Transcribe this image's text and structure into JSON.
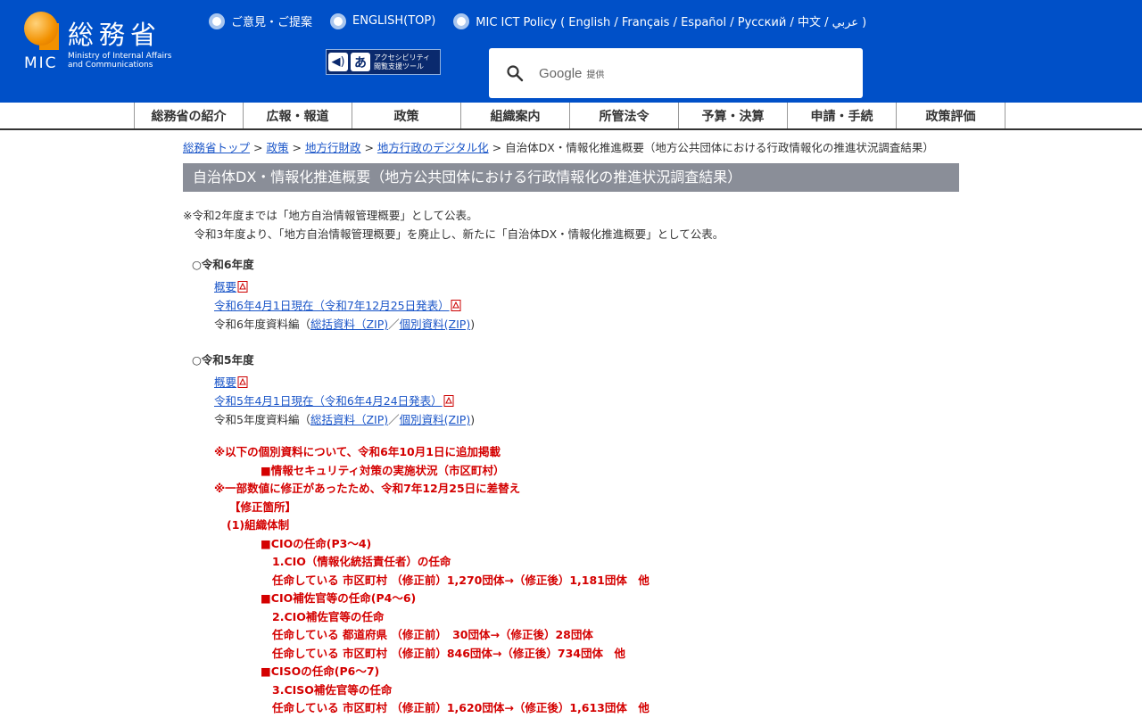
{
  "header": {
    "logo_kanji": "総務省",
    "logo_mic": "MIC",
    "logo_en_line1": "Ministry of Internal Affairs",
    "logo_en_line2": "and Communications",
    "links": [
      "ご意見・ご提案",
      "ENGLISH(TOP)",
      "MIC ICT Policy ( English / Français / Español / Русский / 中文 / عربي )"
    ],
    "accessibility_line1": "アクセシビリティ",
    "accessibility_line2": "閲覧支援ツール",
    "search_brand": "Google",
    "search_by": "提供"
  },
  "nav": [
    "総務省の紹介",
    "広報・報道",
    "政策",
    "組織案内",
    "所管法令",
    "予算・決算",
    "申請・手続",
    "政策評価"
  ],
  "breadcrumb": {
    "links": [
      "総務省トップ",
      "政策",
      "地方行財政",
      "地方行政のデジタル化"
    ],
    "separator": ">",
    "current": "自治体DX・情報化推進概要（地方公共団体における行政情報化の推進状況調査結果）"
  },
  "page_title": "自治体DX・情報化推進概要（地方公共団体における行政情報化の推進状況調査結果）",
  "notes": [
    "※令和2年度までは「地方自治情報管理概要」として公表。",
    "　令和3年度より、「地方自治情報管理概要」を廃止し、新たに「自治体DX・情報化推進概要」として公表。"
  ],
  "sections": [
    {
      "heading": "○令和6年度",
      "overview": "概要",
      "report": "令和6年4月1日現在（令和7年12月25日発表）",
      "materials_prefix": "令和6年度資料編（",
      "materials_zip1": "総括資料（ZIP)",
      "materials_sep": "／",
      "materials_zip2": "個別資料(ZIP)",
      "materials_suffix": ")"
    },
    {
      "heading": "○令和5年度",
      "overview": "概要",
      "report": "令和5年4月1日現在（令和6年4月24日発表）",
      "materials_prefix": "令和5年度資料編（",
      "materials_zip1": "総括資料（ZIP)",
      "materials_sep": "／",
      "materials_zip2": "個別資料(ZIP)",
      "materials_suffix": ")"
    }
  ],
  "notice": [
    "※以下の個別資料について、令和6年10月1日に追加掲載",
    "■情報セキュリティ対策の実施状況（市区町村）",
    "※一部数値に修正があったため、令和7年12月25日に差替え",
    "【修正箇所】",
    "(1)組織体制",
    "■CIOの任命(P3～4)",
    "1.CIO（情報化統括責任者）の任命",
    "任命している 市区町村 （修正前）1,270団体→（修正後）1,181団体　他",
    "■CIO補佐官等の任命(P4～6)",
    "2.CIO補佐官等の任命",
    "任命している 都道府県 （修正前）　30団体→（修正後）28団体",
    "任命している 市区町村 （修正前）846団体→（修正後）734団体　他",
    "■CISOの任命(P6～7)",
    "3.CISO補佐官等の任命",
    "任命している 市区町村 （修正前）1,620団体→（修正後）1,613団体　他"
  ],
  "colors": {
    "header_bg": "#0050c8",
    "title_bar_bg": "#8a8e98",
    "link": "#1a55c8",
    "notice_red": "#d40000",
    "logo_orange": "#f29100"
  }
}
